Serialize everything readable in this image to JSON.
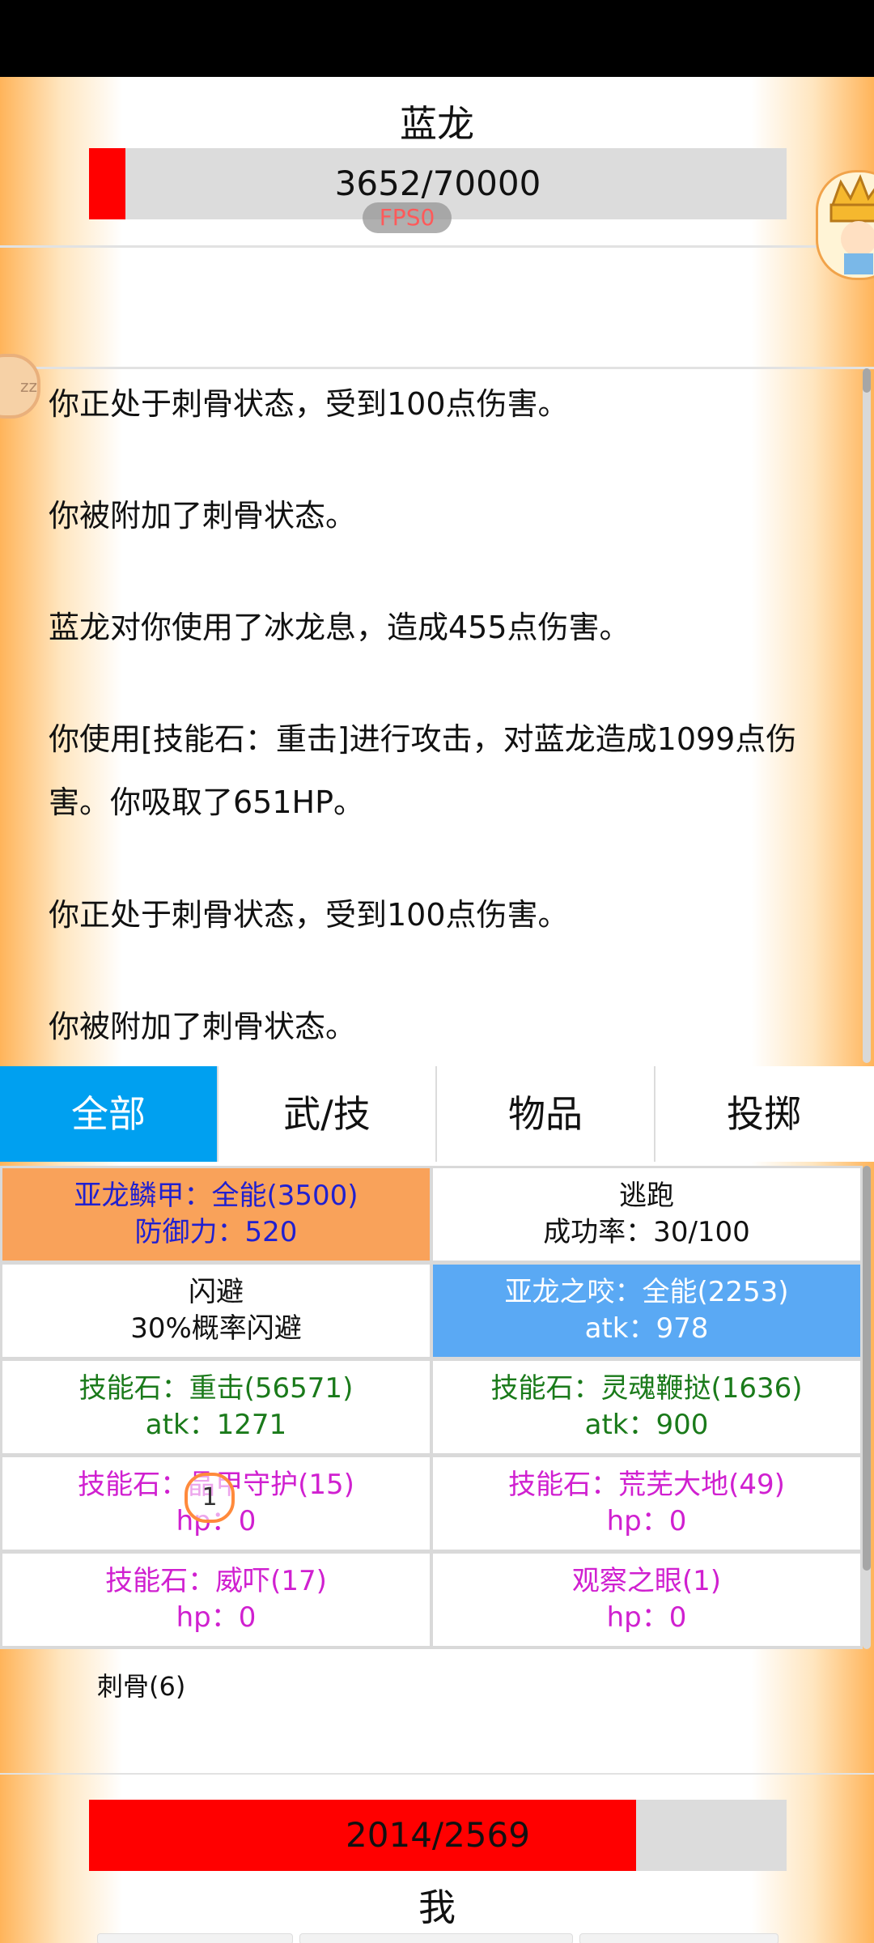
{
  "enemy": {
    "name": "蓝龙",
    "hp_text": "3652/70000",
    "hp_fraction": 0.052
  },
  "fps_label": "FPS0",
  "log": [
    "你正处于刺骨状态，受到100点伤害。",
    "你被附加了刺骨状态。",
    "蓝龙对你使用了冰龙息，造成455点伤害。",
    "你使用[技能石：重击]进行攻击，对蓝龙造成1099点伤害。你吸取了651HP。",
    "你正处于刺骨状态，受到100点伤害。",
    "你被附加了刺骨状态。"
  ],
  "tabs": [
    "全部",
    "武/技",
    "物品",
    "投掷"
  ],
  "active_tab": 0,
  "actions": [
    {
      "line1": "亚龙鳞甲：全能(3500)",
      "line2": "防御力：520",
      "text_color": "#2020d0",
      "bg": "#f9a25a"
    },
    {
      "line1": "逃跑",
      "line2": "成功率：30/100",
      "text_color": "#111111",
      "bg": "#ffffff"
    },
    {
      "line1": "闪避",
      "line2": "30%概率闪避",
      "text_color": "#111111",
      "bg": "#ffffff"
    },
    {
      "line1": "亚龙之咬：全能(2253)",
      "line2": "atk：978",
      "text_color": "#ffffff",
      "bg": "#5aa9f4"
    },
    {
      "line1": "技能石：重击(56571)",
      "line2": "atk：1271",
      "text_color": "#1a7a1a",
      "bg": "#ffffff"
    },
    {
      "line1": "技能石：灵魂鞭挞(1636)",
      "line2": "atk：900",
      "text_color": "#1a7a1a",
      "bg": "#ffffff"
    },
    {
      "line1": "技能石：晶甲守护(15)",
      "line2": "hp：0",
      "text_color": "#d020d0",
      "bg": "#ffffff"
    },
    {
      "line1": "技能石：荒芜大地(49)",
      "line2": "hp：0",
      "text_color": "#d020d0",
      "bg": "#ffffff"
    },
    {
      "line1": "技能石：威吓(17)",
      "line2": "hp：0",
      "text_color": "#d020d0",
      "bg": "#ffffff"
    },
    {
      "line1": "观察之眼(1)",
      "line2": "hp：0",
      "text_color": "#d020d0",
      "bg": "#ffffff"
    }
  ],
  "status_effect": "刺骨(6)",
  "marker_label": "1",
  "player": {
    "name": "我",
    "hp_text": "2014/2569",
    "hp_fraction": 0.784
  },
  "avatar_icon": "king-avatar-icon",
  "sleep_icon_text": "zz"
}
